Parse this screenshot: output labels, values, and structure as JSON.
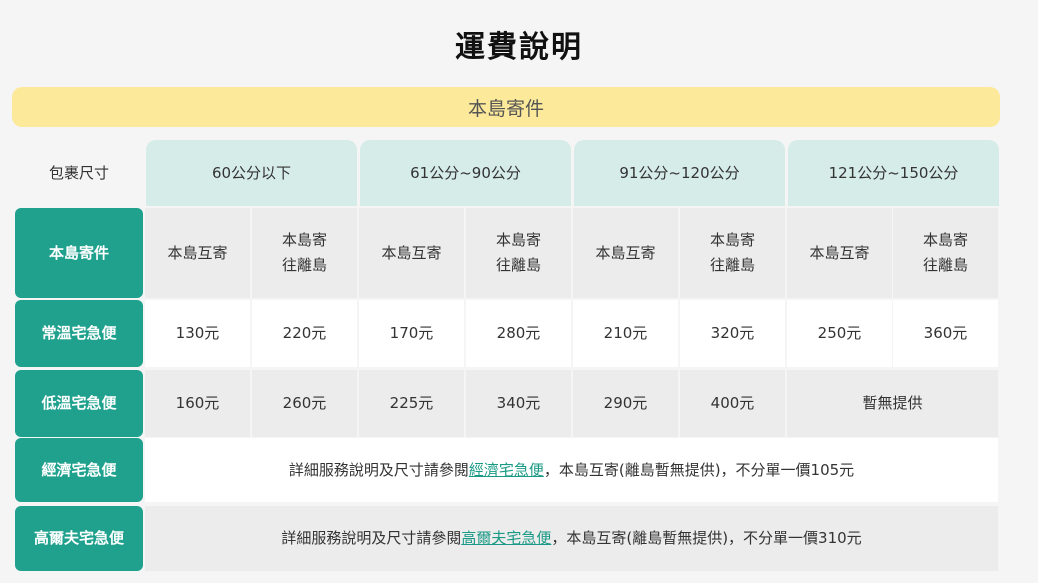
{
  "title": "運費說明",
  "banner": "本島寄件",
  "header": {
    "corner": "包裹尺寸",
    "sizes": [
      "60公分以下",
      "61公分~90公分",
      "91公分~120公分",
      "121公分~150公分"
    ]
  },
  "rows": {
    "sub": {
      "label": "本島寄件",
      "cells": [
        "本島互寄",
        "本島寄\n往離島",
        "本島互寄",
        "本島寄\n往離島",
        "本島互寄",
        "本島寄\n往離島",
        "本島互寄",
        "本島寄\n往離島"
      ]
    },
    "normal": {
      "label": "常溫宅急便",
      "cells": [
        "130元",
        "220元",
        "170元",
        "280元",
        "210元",
        "320元",
        "250元",
        "360元"
      ]
    },
    "cold": {
      "label": "低溫宅急便",
      "cells": [
        "160元",
        "260元",
        "225元",
        "340元",
        "290元",
        "400元"
      ],
      "unavailable": "暫無提供"
    },
    "economy": {
      "label": "經濟宅急便",
      "before": "詳細服務說明及尺寸請參閱",
      "link": "經濟宅急便",
      "after": "，本島互寄(離島暫無提供)，不分單一價105元"
    },
    "golf": {
      "label": "高爾夫宅急便",
      "before": "詳細服務說明及尺寸請參閱",
      "link": "高爾夫宅急便",
      "after": "，本島互寄(離島暫無提供)，不分單一價310元"
    }
  }
}
